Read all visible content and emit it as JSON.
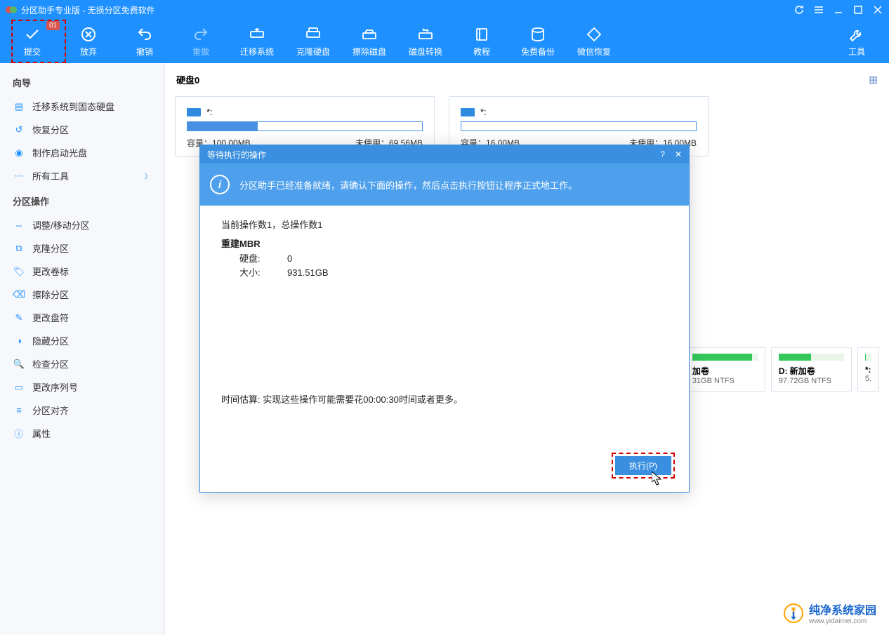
{
  "window": {
    "title": "分区助手专业版 - 无损分区免费软件"
  },
  "toolbar": {
    "commit": "提交",
    "commit_badge": "01",
    "discard": "放弃",
    "undo": "撤销",
    "redo": "重做",
    "migrate": "迁移系统",
    "clone": "克隆硬盘",
    "wipe": "擦除磁盘",
    "convert": "磁盘转换",
    "tutorial": "教程",
    "backup": "免费备份",
    "wechat": "微信恢复",
    "tools": "工具"
  },
  "sidebar": {
    "wizards_header": "向导",
    "wizards": [
      {
        "id": "migrate-ssd",
        "label": "迁移系统到固态硬盘"
      },
      {
        "id": "recover",
        "label": "恢复分区"
      },
      {
        "id": "bootdisc",
        "label": "制作启动光盘"
      },
      {
        "id": "alltools",
        "label": "所有工具",
        "expandable": true
      }
    ],
    "partops_header": "分区操作",
    "partops": [
      {
        "id": "resize",
        "label": "调整/移动分区"
      },
      {
        "id": "clonep",
        "label": "克隆分区"
      },
      {
        "id": "label",
        "label": "更改卷标"
      },
      {
        "id": "wipep",
        "label": "擦除分区"
      },
      {
        "id": "letter",
        "label": "更改盘符"
      },
      {
        "id": "hide",
        "label": "隐藏分区"
      },
      {
        "id": "check",
        "label": "检查分区"
      },
      {
        "id": "serial",
        "label": "更改序列号"
      },
      {
        "id": "align",
        "label": "分区对齐"
      },
      {
        "id": "prop",
        "label": "属性"
      }
    ]
  },
  "disk": {
    "title": "硬盘0",
    "boxes": [
      {
        "name": "*:",
        "fill": 30,
        "cap_label": "容量：",
        "cap": "100.00MB",
        "free_label": "未使用：",
        "free": "69.56MB"
      },
      {
        "name": "*:",
        "fill": 0,
        "cap_label": "容量：",
        "cap": "16.00MB",
        "free_label": "未使用：",
        "free": "16.00MB"
      }
    ],
    "parts": [
      {
        "name": "加卷",
        "size": "31GB NTFS",
        "fill": 92
      },
      {
        "name": "D: 新加卷",
        "size": "97.72GB NTFS",
        "fill": 50
      },
      {
        "name": "*:",
        "size": "5.",
        "fill": 10
      }
    ]
  },
  "modal": {
    "title": "等待执行的操作",
    "info": "分区助手已经准备就绪，请确认下面的操作，然后点击执行按钮让程序正式地工作。",
    "ops_line": "当前操作数1，总操作数1",
    "group": "重建MBR",
    "rows": [
      {
        "k": "硬盘:",
        "v": "0"
      },
      {
        "k": "大小:",
        "v": "931.51GB"
      }
    ],
    "estimate": "时间估算: 实现这些操作可能需要花00:00:30时间或者更多。",
    "exec": "执行(P)"
  },
  "watermark": {
    "brand": "纯净系统家园",
    "url": "www.yidaimei.com"
  }
}
